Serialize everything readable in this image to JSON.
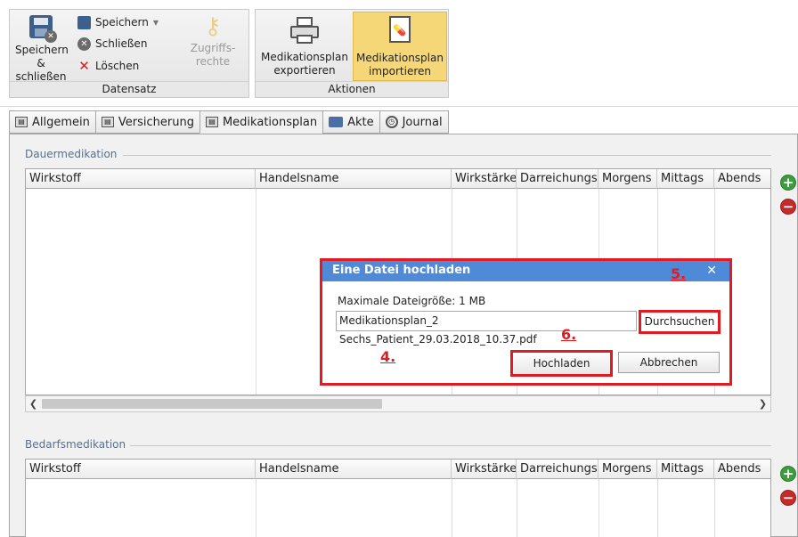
{
  "ribbon": {
    "datensatz": {
      "save_close_label": "Speichern\n& schließen",
      "save_label": "Speichern",
      "close_label": "Schließen",
      "delete_label": "Löschen",
      "access_label": "Zugriffs-\nrechte",
      "group_label": "Datensatz"
    },
    "aktionen": {
      "export_label": "Medikationsplan\nexportieren",
      "import_label": "Medikationsplan\nimportieren",
      "group_label": "Aktionen"
    }
  },
  "tabs": [
    {
      "label": "Allgemein"
    },
    {
      "label": "Versicherung"
    },
    {
      "label": "Medikationsplan"
    },
    {
      "label": "Akte"
    },
    {
      "label": "Journal"
    }
  ],
  "dauermedikation": {
    "title": "Dauermedikation",
    "columns": [
      "Wirkstoff",
      "Handelsname",
      "Wirkstärke",
      "Darreichungsfo",
      "Morgens",
      "Mittags",
      "Abends"
    ]
  },
  "bedarfsmedikation": {
    "title": "Bedarfsmedikation",
    "columns": [
      "Wirkstoff",
      "Handelsname",
      "Wirkstärke",
      "Darreichungsfo",
      "Morgens",
      "Mittags",
      "Abends"
    ]
  },
  "dialog": {
    "title": "Eine Datei hochladen",
    "close": "✕",
    "max_size_label": "Maximale Dateigröße: 1 MB",
    "file_value": "Medikationsplan_2 Sechs_Patient_29.03.2018_10.37.pdf",
    "browse_label": "Durchsuchen",
    "upload_label": "Hochladen",
    "cancel_label": "Abbrechen"
  },
  "steps": {
    "four": "4.",
    "five": "5.",
    "six": "6."
  },
  "colors": {
    "accent_red": "#e11b22",
    "dialog_title": "#4f8ad8",
    "highlight": "#f6d778"
  },
  "icons": [
    "save-close-icon",
    "save-icon",
    "close-circle-icon",
    "delete-x-icon",
    "key-icon",
    "printer-icon",
    "medication-doc-icon",
    "plus-icon",
    "minus-icon",
    "folder-icon",
    "clock-icon"
  ]
}
